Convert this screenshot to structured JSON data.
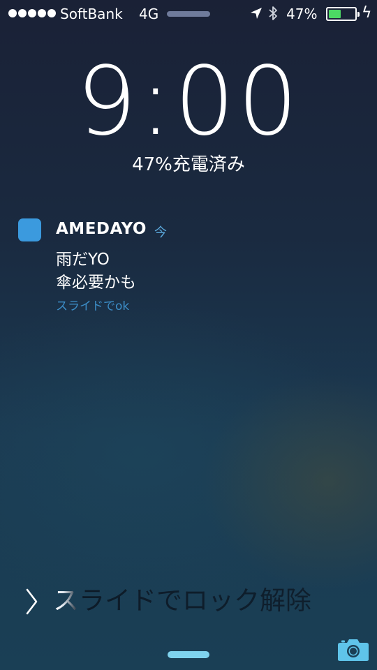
{
  "status_bar": {
    "signal_dots": 5,
    "carrier": "SoftBank",
    "network": "4G",
    "battery_percent_text": "47%",
    "battery_level": 0.47,
    "battery_color": "#4cd964"
  },
  "lock_screen": {
    "time": "9:00",
    "charging_status": "47%充電済み"
  },
  "notification": {
    "app_name": "AMEDAYO",
    "time": "今",
    "line1": "雨だYO",
    "line2": "傘必要かも",
    "action_hint": "スライドでok",
    "icon_color": "#3b9ade"
  },
  "unlock": {
    "text": "スライドでロック解除"
  },
  "icons": [
    "location-arrow-icon",
    "bluetooth-icon",
    "battery-icon",
    "charging-bolt-icon",
    "chevron-right-icon",
    "camera-icon"
  ]
}
